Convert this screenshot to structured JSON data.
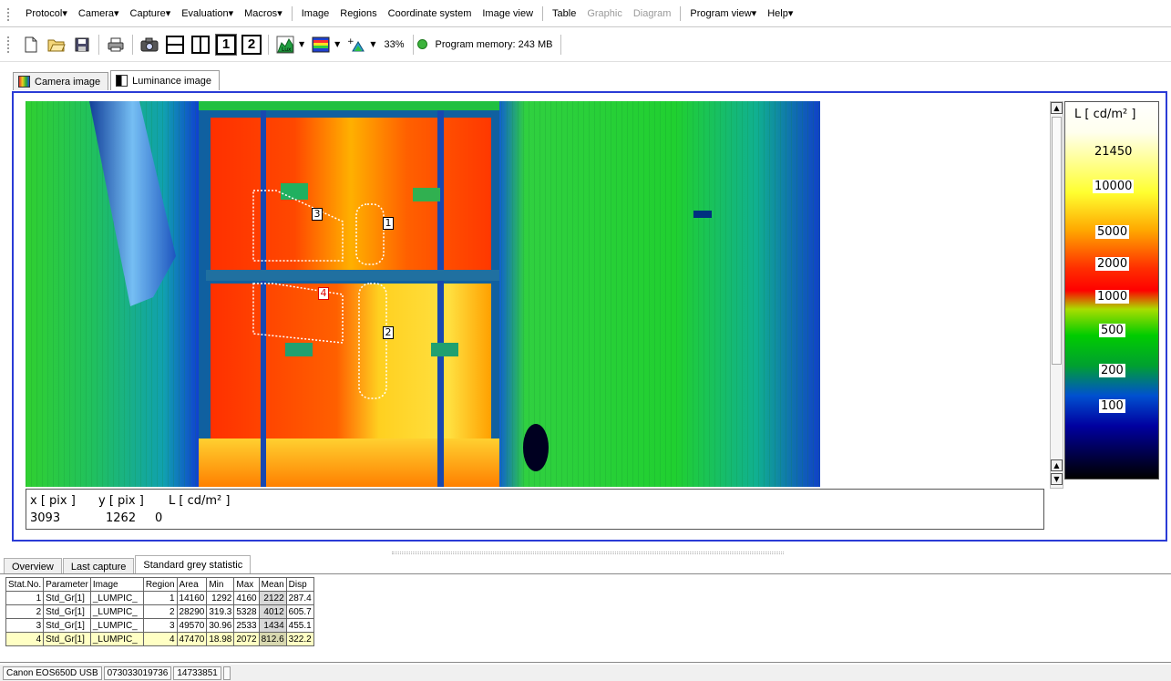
{
  "menu": {
    "items": [
      {
        "label": "Protocol",
        "dropdown": true
      },
      {
        "label": "Camera",
        "dropdown": true
      },
      {
        "label": "Capture",
        "dropdown": true
      },
      {
        "label": "Evaluation",
        "dropdown": true
      },
      {
        "label": "Macros",
        "dropdown": true
      },
      {
        "label": "Image"
      },
      {
        "label": "Regions"
      },
      {
        "label": "Coordinate system"
      },
      {
        "label": "Image view"
      },
      {
        "label": "Table"
      },
      {
        "label": "Graphic",
        "disabled": true
      },
      {
        "label": "Diagram",
        "disabled": true
      },
      {
        "label": "Program view",
        "dropdown": true
      },
      {
        "label": "Help",
        "dropdown": true
      }
    ]
  },
  "toolbar": {
    "view_one": "1",
    "view_two": "2",
    "zoom": "33%",
    "memory": "Program memory: 243 MB",
    "icons": [
      "new-file-icon",
      "open-folder-icon",
      "save-icon",
      "print-icon",
      "camera-icon",
      "split-horizontal-icon",
      "split-vertical-icon",
      "view-one-icon",
      "view-two-icon",
      "false-color-icon",
      "palette-icon",
      "zoom-icon"
    ]
  },
  "image_tabs": [
    {
      "label": "Camera image",
      "active": false
    },
    {
      "label": "Luminance image",
      "active": true
    }
  ],
  "coordinates": {
    "x_header": "x [ pix ]",
    "y_header": "y [ pix ]",
    "l_header": "L [ cd/m² ]",
    "x_value": "3093",
    "y_value": "1262",
    "l_value": "0"
  },
  "legend": {
    "unit": "L [ cd/m² ]",
    "labels": [
      "21450",
      "10000",
      "5000",
      "2000",
      "1000",
      "500",
      "200",
      "100"
    ]
  },
  "regions": [
    {
      "label": "1",
      "color": "#ffffff"
    },
    {
      "label": "2",
      "color": "#ffffff"
    },
    {
      "label": "3",
      "color": "#ffffff"
    },
    {
      "label": "4",
      "color": "#ff0000"
    }
  ],
  "bottom_tabs": [
    {
      "label": "Overview",
      "active": false
    },
    {
      "label": "Last capture",
      "active": false
    },
    {
      "label": "Standard grey statistic",
      "active": true
    }
  ],
  "stats": {
    "columns": [
      "Stat.No.",
      "Parameter",
      "Image",
      "Region",
      "Area",
      "Min",
      "Max",
      "Mean",
      "Disp"
    ],
    "rows": [
      [
        "1",
        "Std_Gr[1]",
        "_LUMPIC_",
        "1",
        "14160",
        "1292",
        "4160",
        "2122",
        "287.4"
      ],
      [
        "2",
        "Std_Gr[1]",
        "_LUMPIC_",
        "2",
        "28290",
        "319.3",
        "5328",
        "4012",
        "605.7"
      ],
      [
        "3",
        "Std_Gr[1]",
        "_LUMPIC_",
        "3",
        "49570",
        "30.96",
        "2533",
        "1434",
        "455.1"
      ],
      [
        "4",
        "Std_Gr[1]",
        "_LUMPIC_",
        "4",
        "47470",
        "18.98",
        "2072",
        "812.6",
        "322.2"
      ]
    ],
    "highlight_row": 3
  },
  "status_bar": [
    "Canon EOS650D USB",
    "073033019736",
    "14733851"
  ]
}
